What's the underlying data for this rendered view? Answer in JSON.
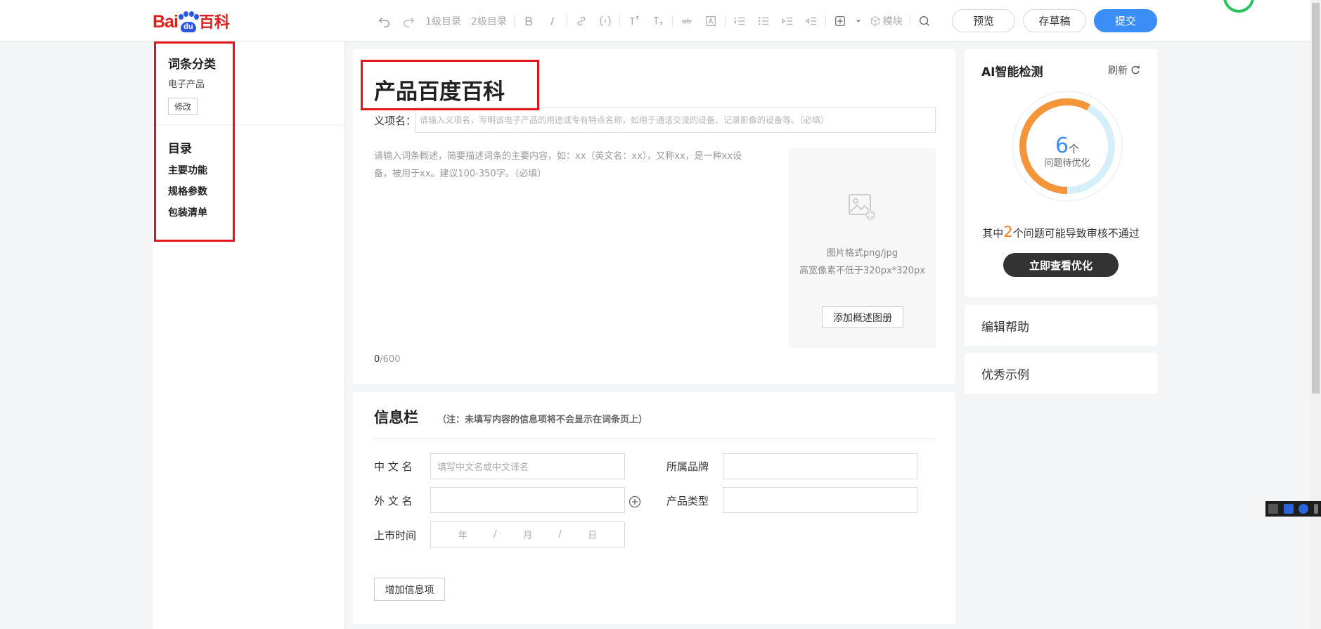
{
  "logo": {
    "bai": "Bai",
    "du": "du",
    "ke": "百科"
  },
  "toolbar": {
    "toc1": "1级目录",
    "toc2": "2级目录",
    "module": "模块",
    "preview": "预览",
    "save_draft": "存草稿",
    "submit": "提交"
  },
  "sidebar": {
    "category_title": "词条分类",
    "category_value": "电子产品",
    "modify": "修改",
    "toc_title": "目录",
    "toc_items": [
      "主要功能",
      "规格参数",
      "包装清单"
    ]
  },
  "main": {
    "title": "产品百度百科",
    "sense_label": "义项名：",
    "sense_placeholder": "请输入义项名，写明该电子产品的用途或专有特点名称，如用于通话交流的设备、记录影像的设备等。（必填）",
    "summary_placeholder": "请输入词条概述，简要描述词条的主要内容，如：xx（英文名：xx），又称xx，是一种xx设备，被用于xx。建议100-350字。（必填）",
    "image_hint1": "图片格式png/jpg",
    "image_hint2": "高宽像素不低于320px*320px",
    "add_album": "添加概述图册",
    "count": "0",
    "count_max": "/600"
  },
  "infobox": {
    "title": "信息栏",
    "note": "（注：未填写内容的信息项将不会显示在词条页上）",
    "cn_name_label": "中 文 名",
    "cn_name_placeholder": "填写中文名或中文译名",
    "brand_label": "所属品牌",
    "foreign_name_label": "外 文 名",
    "type_label": "产品类型",
    "date_label": "上市时间",
    "date_year": "年",
    "date_sep": "/",
    "date_month": "月",
    "date_day": "日",
    "add_item": "增加信息项"
  },
  "ai": {
    "title": "AI智能检测",
    "refresh": "刷新",
    "count": "6",
    "unit": "个",
    "sub": "问题待优化",
    "desc_pre": "其中",
    "desc_num": "2",
    "desc_post": "个问题可能导致审核不通过",
    "button": "立即查看优化",
    "progress_fraction": 0.58
  },
  "help": "编辑帮助",
  "example": "优秀示例",
  "colors": {
    "accent": "#3a8ef6",
    "orange": "#f5821f",
    "highlight_box": "#e0161c"
  }
}
